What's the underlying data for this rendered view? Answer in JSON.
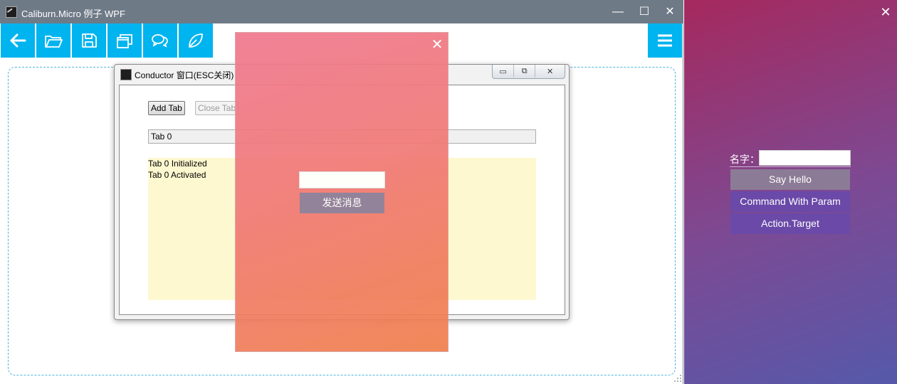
{
  "main_window": {
    "title": "Caliburn.Micro 例子 WPF",
    "controls": {
      "minimize": "—",
      "maximize": "☐",
      "close": "✕"
    },
    "toolbar": {
      "buttons": [
        {
          "name": "back-arrow-icon"
        },
        {
          "name": "open-folder-icon"
        },
        {
          "name": "save-icon"
        },
        {
          "name": "windows-icon"
        },
        {
          "name": "chat-icon"
        },
        {
          "name": "leaf-icon"
        }
      ],
      "menu": {
        "name": "hamburger-menu-icon"
      },
      "accent": "#00b4ef"
    }
  },
  "conductor_window": {
    "title": "Conductor 窗口(ESC关闭)",
    "controls": {
      "minimize": "▭",
      "maximize": "⧉",
      "close": "✕"
    },
    "add_tab_label": "Add Tab",
    "close_tab_label": "Close Tab",
    "tabs": [
      "Tab 0"
    ],
    "log": [
      "Tab 0 Initialized",
      "Tab 0 Activated"
    ]
  },
  "popup": {
    "close_label": "✕",
    "input_value": "",
    "send_label": "发送消息",
    "colors": {
      "top": "#f07990",
      "bottom": "#f0804c"
    }
  },
  "side_panel": {
    "close_label": "✕",
    "name_label": "名字：",
    "name_value": "",
    "buttons": [
      "Say Hello",
      "Command With Param",
      "Action.Target"
    ],
    "colors": {
      "top": "#a5295e",
      "bottom": "#5659aa"
    }
  }
}
